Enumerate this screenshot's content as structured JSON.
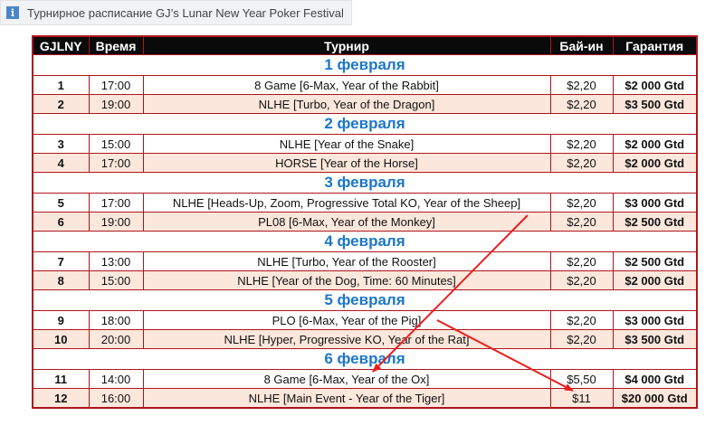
{
  "caption": {
    "icon": "info-icon",
    "text": "Турнирное расписание GJ’s Lunar New Year Poker Festival"
  },
  "table": {
    "headers": [
      "GJLNY",
      "Время",
      "Турнир",
      "Бай-ин",
      "Гарантия"
    ],
    "groups": [
      {
        "date": "1 февраля",
        "rows": [
          {
            "num": "1",
            "time": "17:00",
            "name": "8 Game [6-Max, Year of the Rabbit]",
            "buyin": "$2,20",
            "gtd": "$2 000 Gtd"
          },
          {
            "num": "2",
            "time": "19:00",
            "name": "NLHE [Turbo, Year of the Dragon]",
            "buyin": "$2,20",
            "gtd": "$3 500 Gtd"
          }
        ]
      },
      {
        "date": "2 февраля",
        "rows": [
          {
            "num": "3",
            "time": "15:00",
            "name": "NLHE [Year of the Snake]",
            "buyin": "$2,20",
            "gtd": "$2 000 Gtd"
          },
          {
            "num": "4",
            "time": "17:00",
            "name": "HORSE [Year of the Horse]",
            "buyin": "$2,20",
            "gtd": "$2 000 Gtd"
          }
        ]
      },
      {
        "date": "3 февраля",
        "rows": [
          {
            "num": "5",
            "time": "17:00",
            "name": "NLHE [Heads-Up, Zoom, Progressive Total KO, Year of the Sheep]",
            "buyin": "$2,20",
            "gtd": "$3 000 Gtd"
          },
          {
            "num": "6",
            "time": "19:00",
            "name": "PL08 [6-Max, Year of the Monkey]",
            "buyin": "$2,20",
            "gtd": "$2 500 Gtd"
          }
        ]
      },
      {
        "date": "4 февраля",
        "rows": [
          {
            "num": "7",
            "time": "13:00",
            "name": "NLHE [Turbo, Year of the Rooster]",
            "buyin": "$2,20",
            "gtd": "$2 500 Gtd"
          },
          {
            "num": "8",
            "time": "15:00",
            "name": "NLHE [Year of the Dog, Time: 60 Minutes]",
            "buyin": "$2,20",
            "gtd": "$2 000 Gtd"
          }
        ]
      },
      {
        "date": "5 февраля",
        "rows": [
          {
            "num": "9",
            "time": "18:00",
            "name": "PLO [6-Max, Year of the Pig]",
            "buyin": "$2,20",
            "gtd": "$3 000 Gtd"
          },
          {
            "num": "10",
            "time": "20:00",
            "name": "NLHE [Hyper, Progressive KO, Year of the Rat]",
            "buyin": "$2,20",
            "gtd": "$3 500 Gtd"
          }
        ]
      },
      {
        "date": "6 февраля",
        "rows": [
          {
            "num": "11",
            "time": "14:00",
            "name": "8 Game [6-Max, Year of the Ox]",
            "buyin": "$5,50",
            "gtd": "$4 000 Gtd"
          },
          {
            "num": "12",
            "time": "16:00",
            "name": "NLHE [Main Event - Year of the Tiger]",
            "buyin": "$11",
            "gtd": "$20 000 Gtd"
          }
        ]
      }
    ]
  },
  "annotations": {
    "arrow_color": "#ee1c1c"
  }
}
